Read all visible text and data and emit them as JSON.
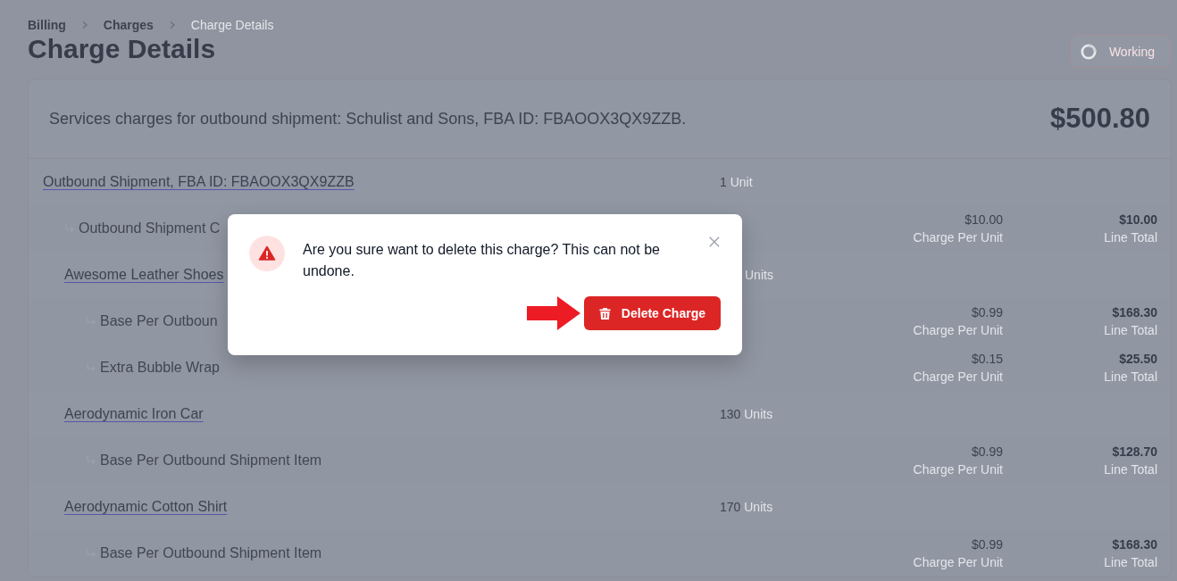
{
  "breadcrumb": [
    {
      "label": "Billing",
      "current": false
    },
    {
      "label": "Charges",
      "current": false
    },
    {
      "label": "Charge Details",
      "current": true
    }
  ],
  "title": "Charge Details",
  "working_button": {
    "label": "Working"
  },
  "summary": {
    "text": "Services charges for outbound shipment: Schulist and Sons, FBA ID: FBAOOX3QX9ZZB.",
    "total": "$500.80"
  },
  "shipment": {
    "name": "Outbound Shipment, FBA ID: FBAOOX3QX9ZZB",
    "quantity": "1",
    "unit": "Unit",
    "charges": [
      {
        "name": "Outbound Shipment C",
        "price": "$10.00",
        "price_label": "Charge Per Unit",
        "total": "$10.00",
        "total_label": "Line Total"
      }
    ],
    "items": [
      {
        "name": "Awesome Leather Shoes",
        "unit": "Units",
        "charges": [
          {
            "name": "Base Per Outboun",
            "price": "$0.99",
            "price_label": "Charge Per Unit",
            "total": "$168.30",
            "total_label": "Line Total"
          },
          {
            "name": "Extra Bubble Wrap",
            "price": "$0.15",
            "price_label": "Charge Per Unit",
            "total": "$25.50",
            "total_label": "Line Total"
          }
        ]
      },
      {
        "name": "Aerodynamic Iron Car",
        "quantity": "130",
        "unit": "Units",
        "charges": [
          {
            "name": "Base Per Outbound Shipment Item",
            "price": "$0.99",
            "price_label": "Charge Per Unit",
            "total": "$128.70",
            "total_label": "Line Total"
          }
        ]
      },
      {
        "name": "Aerodynamic Cotton Shirt",
        "quantity": "170",
        "unit": "Units",
        "charges": [
          {
            "name": "Base Per Outbound Shipment Item",
            "price": "$0.99",
            "price_label": "Charge Per Unit",
            "total": "$168.30",
            "total_label": "Line Total"
          }
        ]
      }
    ]
  },
  "modal": {
    "message": "Are you sure want to delete this charge? This can not be undone.",
    "button": "Delete Charge"
  }
}
